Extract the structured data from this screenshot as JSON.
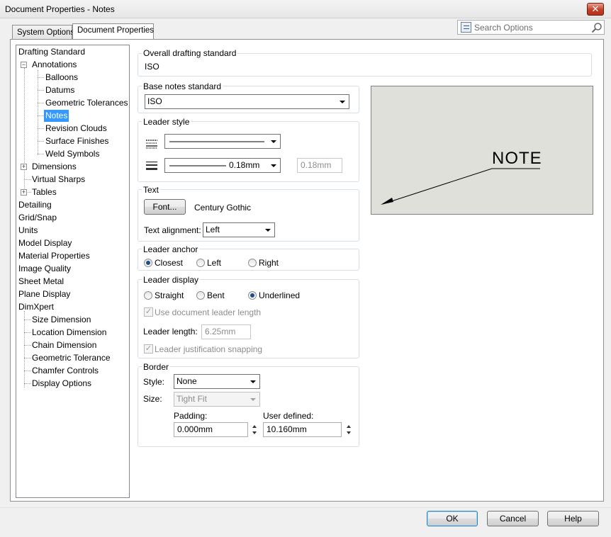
{
  "window": {
    "title": "Document Properties - Notes",
    "close_glyph": "✕"
  },
  "tabs": [
    {
      "label": "System Options",
      "active": false
    },
    {
      "label": "Document Properties",
      "active": true
    }
  ],
  "search": {
    "placeholder": "Search Options"
  },
  "tree": {
    "items": [
      {
        "label": "Drafting Standard"
      },
      {
        "label": "Annotations",
        "expanded": true
      },
      {
        "label": "Balloons"
      },
      {
        "label": "Datums"
      },
      {
        "label": "Geometric Tolerances"
      },
      {
        "label": "Notes",
        "selected": true
      },
      {
        "label": "Revision Clouds"
      },
      {
        "label": "Surface Finishes"
      },
      {
        "label": "Weld Symbols"
      },
      {
        "label": "Dimensions",
        "expanded": false
      },
      {
        "label": "Virtual Sharps"
      },
      {
        "label": "Tables",
        "expanded": false
      },
      {
        "label": "Detailing"
      },
      {
        "label": "Grid/Snap"
      },
      {
        "label": "Units"
      },
      {
        "label": "Model Display"
      },
      {
        "label": "Material Properties"
      },
      {
        "label": "Image Quality"
      },
      {
        "label": "Sheet Metal"
      },
      {
        "label": "Plane Display"
      },
      {
        "label": "DimXpert"
      },
      {
        "label": "Size Dimension"
      },
      {
        "label": "Location Dimension"
      },
      {
        "label": "Chain Dimension"
      },
      {
        "label": "Geometric Tolerance"
      },
      {
        "label": "Chamfer Controls"
      },
      {
        "label": "Display Options"
      }
    ],
    "expander_minus": "−",
    "expander_plus": "+"
  },
  "overall": {
    "label": "Overall drafting standard",
    "value": "ISO"
  },
  "base_notes": {
    "label": "Base notes standard",
    "value": "ISO"
  },
  "leader_style": {
    "label": "Leader style",
    "thickness_value": "0.18mm",
    "custom_thickness": "0.18mm"
  },
  "text": {
    "label": "Text",
    "font_button": "Font...",
    "font_name": "Century Gothic",
    "alignment_label": "Text alignment:",
    "alignment_value": "Left"
  },
  "leader_anchor": {
    "label": "Leader anchor",
    "options": [
      {
        "label": "Closest",
        "selected": true
      },
      {
        "label": "Left",
        "selected": false
      },
      {
        "label": "Right",
        "selected": false
      }
    ]
  },
  "leader_display": {
    "label": "Leader display",
    "options": [
      {
        "label": "Straight",
        "selected": false
      },
      {
        "label": "Bent",
        "selected": false
      },
      {
        "label": "Underlined",
        "selected": true
      }
    ],
    "use_doc_length_label": "Use document leader length",
    "use_doc_length_checked": true,
    "length_label": "Leader length:",
    "length_value": "6.25mm",
    "justification_label": "Leader justification snapping",
    "justification_checked": true,
    "check_glyph": "✓"
  },
  "border": {
    "label": "Border",
    "style_label": "Style:",
    "style_value": "None",
    "size_label": "Size:",
    "size_value": "Tight Fit",
    "padding_label": "Padding:",
    "padding_value": "0.000mm",
    "user_defined_label": "User defined:",
    "user_defined_value": "10.160mm"
  },
  "preview": {
    "note_text": "NOTE"
  },
  "buttons": {
    "ok": "OK",
    "cancel": "Cancel",
    "help": "Help"
  }
}
